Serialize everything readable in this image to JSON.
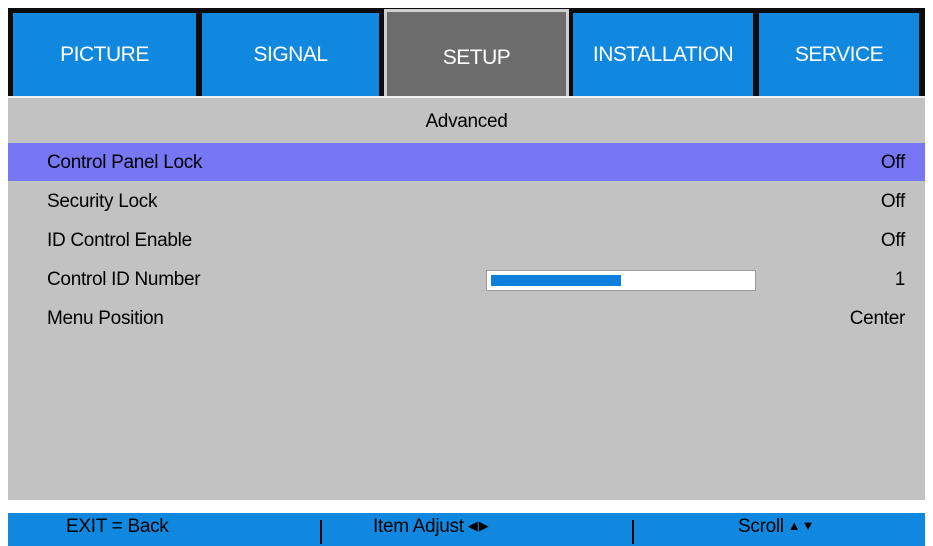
{
  "tabs": [
    {
      "label": "PICTURE",
      "active": false
    },
    {
      "label": "SIGNAL",
      "active": false
    },
    {
      "label": "SETUP",
      "active": true
    },
    {
      "label": "INSTALLATION",
      "active": false
    },
    {
      "label": "SERVICE",
      "active": false
    }
  ],
  "colors": {
    "tab_blue": "#1188e0",
    "tab_active": "#6c6c6c",
    "panel_bg": "#c2c2c2",
    "highlight": "#7777f6",
    "slider_fill": "#0f7fde"
  },
  "menu": {
    "title": "Advanced",
    "items": [
      {
        "label": "Control Panel Lock",
        "value": "Off",
        "selected": true
      },
      {
        "label": "Security Lock",
        "value": "Off",
        "selected": false
      },
      {
        "label": "ID Control Enable",
        "value": "Off",
        "selected": false
      },
      {
        "label": "Control ID Number",
        "value": "1",
        "selected": false,
        "slider_level": 0.5
      },
      {
        "label": "Menu Position",
        "value": "Center",
        "selected": false
      }
    ]
  },
  "status": {
    "exit": "EXIT = Back",
    "separator": "|",
    "adjust": "Item Adjust",
    "adjust_icon": "left-right-arrows-icon",
    "adjust_glyph": "◀▶",
    "scroll": "Scroll",
    "scroll_icon": "up-down-arrows-icon",
    "scroll_glyph": "▲▼"
  }
}
